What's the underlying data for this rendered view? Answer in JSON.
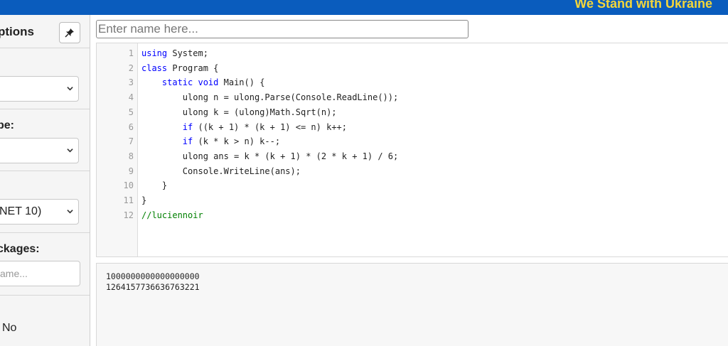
{
  "banner": {
    "text": "We Stand with Ukraine"
  },
  "sidebar": {
    "title": "ptions",
    "pin_icon": "pin-icon",
    "sections": [
      {
        "label": ":",
        "select_value": ""
      },
      {
        "label": "pe:",
        "select_value": ""
      },
      {
        "label": "",
        "select_value": "NET 10)"
      }
    ],
    "packages_label": "ckages:",
    "packages_placeholder": "ame...",
    "no_label": "No"
  },
  "name_input": {
    "placeholder": "Enter name here..."
  },
  "editor": {
    "line_numbers": [
      "1",
      "2",
      "3",
      "4",
      "5",
      "6",
      "7",
      "8",
      "9",
      "10",
      "11",
      "12"
    ],
    "lines": [
      {
        "kw": "using",
        "rest": " System;"
      },
      {
        "kw": "class",
        "rest": " Program {"
      },
      {
        "indent": "    ",
        "kw": "static void",
        "rest": " Main() {"
      },
      {
        "indent": "        ",
        "kw": "",
        "rest": "ulong n = ulong.Parse(Console.ReadLine());"
      },
      {
        "indent": "        ",
        "kw": "",
        "rest": "ulong k = (ulong)Math.Sqrt(n);"
      },
      {
        "indent": "        ",
        "kw": "if",
        "rest": " ((k + 1) * (k + 1) <= n) k++;"
      },
      {
        "indent": "        ",
        "kw": "if",
        "rest": " (k * k > n) k--;"
      },
      {
        "indent": "        ",
        "kw": "",
        "rest": "ulong ans = k * (k + 1) * (2 * k + 1) / 6;"
      },
      {
        "indent": "        ",
        "kw": "",
        "rest": "Console.WriteLine(ans);"
      },
      {
        "indent": "    ",
        "kw": "",
        "rest": "}"
      },
      {
        "kw": "",
        "rest": "}"
      },
      {
        "comment": "//luciennoir"
      }
    ]
  },
  "output": {
    "lines": [
      "1000000000000000000",
      "1264157736636763221"
    ]
  },
  "colors": {
    "banner": "#0a5cbd",
    "banner_text": "#f4d63a",
    "keyword": "#0000ff",
    "comment": "#008000"
  }
}
